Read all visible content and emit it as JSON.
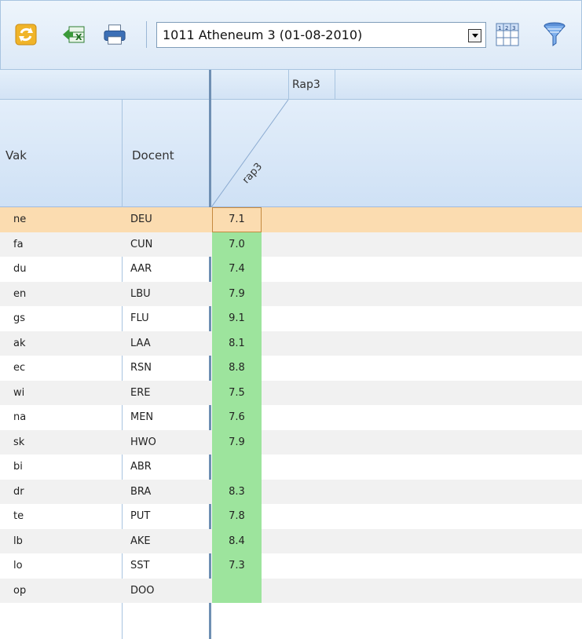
{
  "toolbar": {
    "refresh_icon": "refresh-icon",
    "excel_icon": "excel-export-icon",
    "print_icon": "print-icon",
    "selected_class": "1011 Atheneum 3 (01-08-2010)",
    "grid_icon": "grid-view-icon",
    "filter_icon": "filter-icon"
  },
  "grid": {
    "group_header": "Rap3",
    "col_vak": "Vak",
    "col_docent": "Docent",
    "col_rap3": "rap3",
    "rows": [
      {
        "vak": "ne",
        "docent": "DEU",
        "rap3": "7.1",
        "selected": true
      },
      {
        "vak": "fa",
        "docent": "CUN",
        "rap3": "7.0"
      },
      {
        "vak": "du",
        "docent": "AAR",
        "rap3": "7.4"
      },
      {
        "vak": "en",
        "docent": "LBU",
        "rap3": "7.9"
      },
      {
        "vak": "gs",
        "docent": "FLU",
        "rap3": "9.1"
      },
      {
        "vak": "ak",
        "docent": "LAA",
        "rap3": "8.1"
      },
      {
        "vak": "ec",
        "docent": "RSN",
        "rap3": "8.8"
      },
      {
        "vak": "wi",
        "docent": "ERE",
        "rap3": "7.5"
      },
      {
        "vak": "na",
        "docent": "MEN",
        "rap3": "7.6"
      },
      {
        "vak": "sk",
        "docent": "HWO",
        "rap3": "7.9"
      },
      {
        "vak": "bi",
        "docent": "ABR",
        "rap3": ""
      },
      {
        "vak": "dr",
        "docent": "BRA",
        "rap3": "8.3"
      },
      {
        "vak": "te",
        "docent": "PUT",
        "rap3": "7.8"
      },
      {
        "vak": "lb",
        "docent": "AKE",
        "rap3": "8.4"
      },
      {
        "vak": "lo",
        "docent": "SST",
        "rap3": "7.3"
      },
      {
        "vak": "op",
        "docent": "DOO",
        "rap3": ""
      }
    ]
  },
  "colors": {
    "grade_cell": "#9de49d",
    "selected_row": "#fbdcb0",
    "header_blue": "#d3e3f5"
  }
}
